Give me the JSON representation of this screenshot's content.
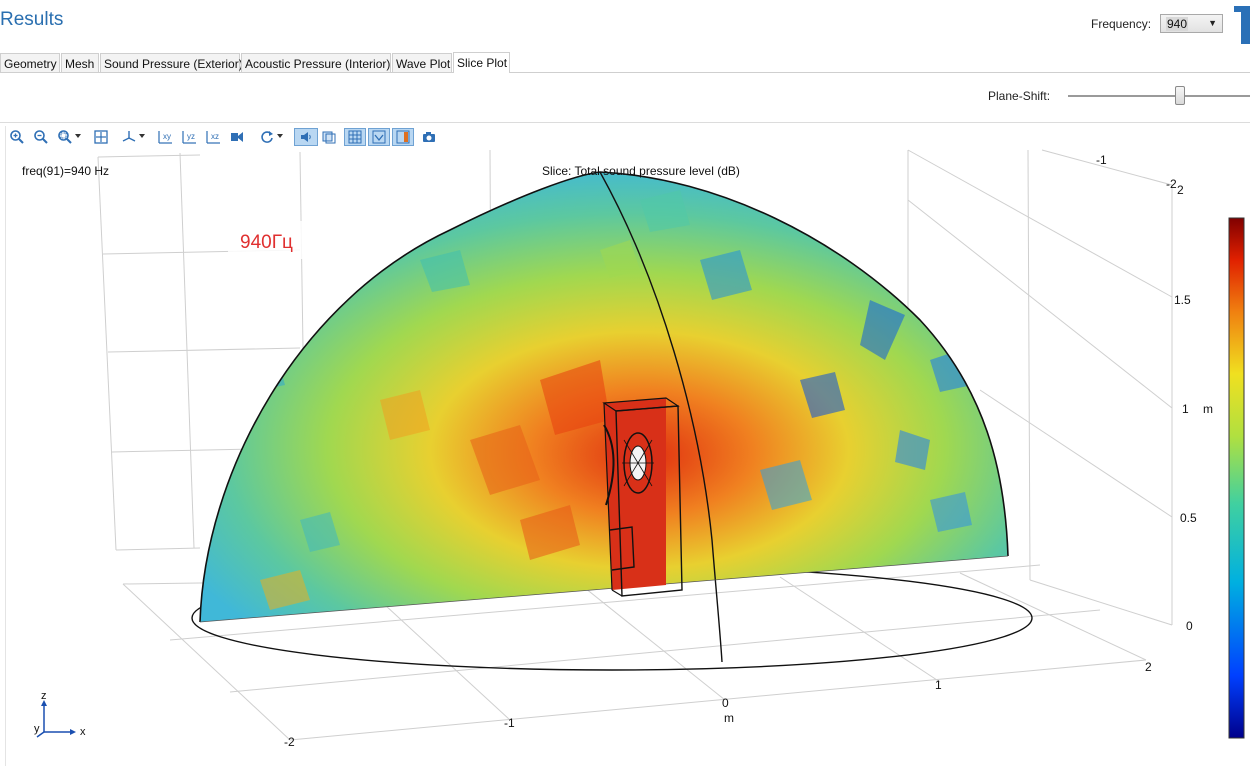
{
  "header": {
    "title": "Results",
    "frequency_label": "Frequency:",
    "frequency_value": "940"
  },
  "tabs": [
    {
      "label": "Geometry",
      "active": false
    },
    {
      "label": "Mesh",
      "active": false
    },
    {
      "label": "Sound Pressure (Exterior)",
      "active": false
    },
    {
      "label": "Acoustic Pressure (Interior)",
      "active": false
    },
    {
      "label": "Wave Plot",
      "active": false
    },
    {
      "label": "Slice Plot",
      "active": true
    }
  ],
  "controls": {
    "plane_shift_label": "Plane-Shift:",
    "plane_shift_level": 0.59
  },
  "toolbar": [
    {
      "icon": "zoom-in-icon"
    },
    {
      "icon": "zoom-out-icon"
    },
    {
      "icon": "zoom-box-icon"
    },
    {
      "icon": "zoom-extents-icon"
    },
    {
      "icon": "view-axes-icon"
    },
    {
      "icon": "view-xy-icon"
    },
    {
      "icon": "view-yz-icon"
    },
    {
      "icon": "view-xz-icon"
    },
    {
      "icon": "camera-view-icon"
    },
    {
      "icon": "rotate-icon"
    },
    {
      "icon": "speaker-icon",
      "active": true
    },
    {
      "icon": "transparency-icon"
    },
    {
      "icon": "grid-icon",
      "active": true
    },
    {
      "icon": "axis-orientation-icon",
      "active": true
    },
    {
      "icon": "legend-icon",
      "active": true
    },
    {
      "icon": "snapshot-icon"
    }
  ],
  "plot": {
    "freq_text": "freq(91)=940 Hz",
    "slice_title": "Slice: Total sound pressure level (dB)",
    "annotation": "940Гц",
    "annotation_color": "#e03030",
    "x_ticks": [
      "-2",
      "-1",
      "0",
      "1",
      "2"
    ],
    "x_unit": "m",
    "y_ticks": [
      "-1",
      "-2"
    ],
    "z_ticks": [
      "0",
      "0.5",
      "1",
      "1.5",
      "2"
    ],
    "z_unit": "m",
    "triad": {
      "z": "z",
      "y": "y",
      "x": "x"
    },
    "colorbar_colors": [
      "#00008b",
      "#0050ff",
      "#00b0e0",
      "#40d0a0",
      "#b0e040",
      "#f0e020",
      "#f08010",
      "#e02000",
      "#800000"
    ]
  }
}
